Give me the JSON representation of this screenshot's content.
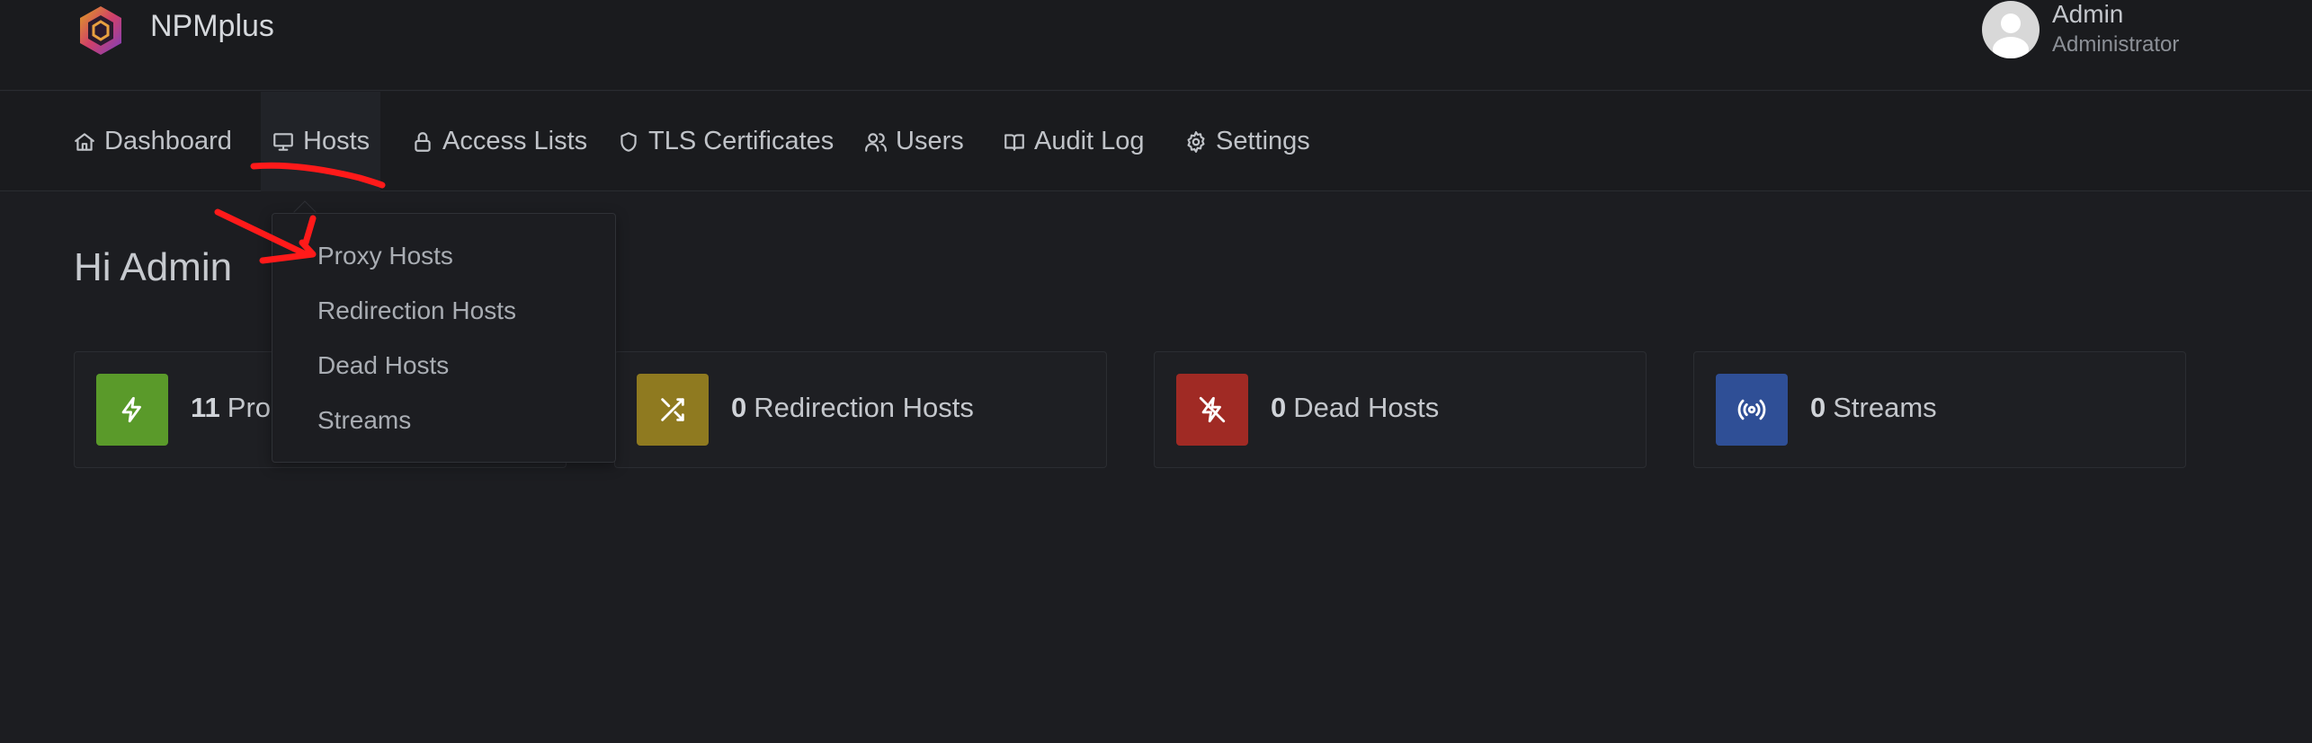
{
  "app": {
    "brand_name": "NPMplus",
    "logo_icon": "hexagon-logo-icon"
  },
  "user": {
    "name": "Admin",
    "role": "Administrator",
    "avatar_icon": "user-avatar-icon"
  },
  "nav": {
    "active": "Hosts",
    "items": [
      {
        "label": "Dashboard",
        "icon": "home-icon"
      },
      {
        "label": "Hosts",
        "icon": "monitor-icon"
      },
      {
        "label": "Access Lists",
        "icon": "lock-icon"
      },
      {
        "label": "TLS Certificates",
        "icon": "shield-icon"
      },
      {
        "label": "Users",
        "icon": "users-icon"
      },
      {
        "label": "Audit Log",
        "icon": "book-icon"
      },
      {
        "label": "Settings",
        "icon": "gear-icon"
      }
    ]
  },
  "dropdown": {
    "items": [
      "Proxy Hosts",
      "Redirection Hosts",
      "Dead Hosts",
      "Streams"
    ]
  },
  "main": {
    "greeting": "Hi Admin"
  },
  "stats": [
    {
      "count": "11",
      "label": "Proxy Hosts",
      "visible_label": "Pro",
      "icon": "bolt-icon",
      "color": "#5a9a2a"
    },
    {
      "count": "0",
      "label": "Redirection Hosts",
      "icon": "shuffle-icon",
      "color": "#8f7a20"
    },
    {
      "count": "0",
      "label": "Dead Hosts",
      "icon": "bolt-off-icon",
      "color": "#a02a24"
    },
    {
      "count": "0",
      "label": "Streams",
      "icon": "broadcast-icon",
      "color": "#2f4f96"
    }
  ],
  "colors": {
    "background": "#1c1d21",
    "header": "#1a1b1e",
    "annotation_red": "#ff0000"
  }
}
